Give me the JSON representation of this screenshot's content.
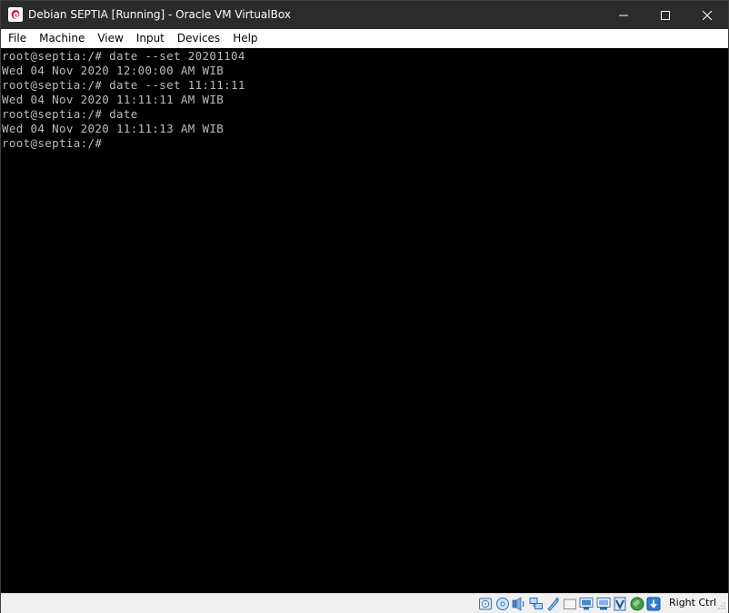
{
  "window": {
    "title": "Debian SEPTIA [Running] - Oracle VM VirtualBox"
  },
  "menu": [
    "File",
    "Machine",
    "View",
    "Input",
    "Devices",
    "Help"
  ],
  "terminal": {
    "lines": [
      "root@septia:/# date --set 20201104",
      "Wed 04 Nov 2020 12:00:00 AM WIB",
      "root@septia:/# date --set 11:11:11",
      "Wed 04 Nov 2020 11:11:11 AM WIB",
      "root@septia:/# date",
      "Wed 04 Nov 2020 11:11:13 AM WIB",
      "root@septia:/#"
    ]
  },
  "statusbar": {
    "icons": [
      "hard-disk-icon",
      "optical-drive-icon",
      "audio-icon",
      "network-icon",
      "usb-icon",
      "shared-folders-icon",
      "display-icon",
      "video-capture-icon",
      "virtualization-icon",
      "mouse-integration-icon",
      "keyboard-capture-icon"
    ],
    "host_key": "Right Ctrl"
  },
  "colors": {
    "titlebar": "#2b2b2b",
    "terminal_bg": "#000000",
    "terminal_fg": "#bcbcbc",
    "accent_blue": "#1e6fc0"
  }
}
